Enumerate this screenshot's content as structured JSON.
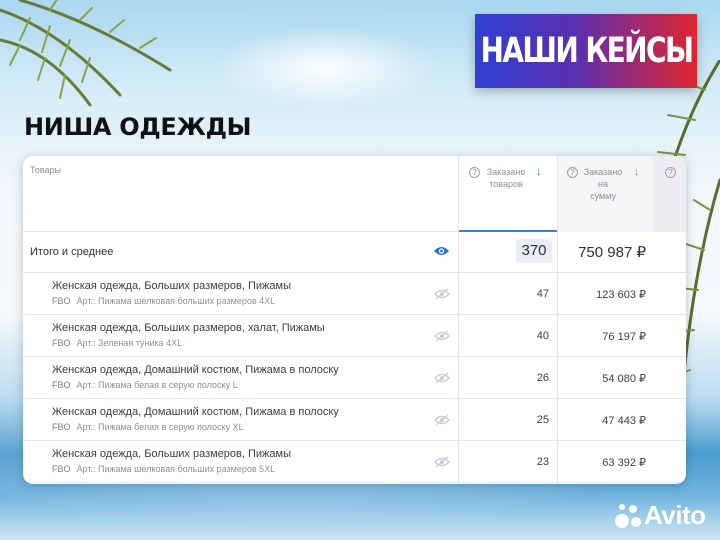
{
  "banner": {
    "label": "НАШИ КЕЙСЫ"
  },
  "niche_title": "НИША ОДЕЖДЫ",
  "table": {
    "header": {
      "goods": "Товары",
      "ordered_items_line1": "Заказано",
      "ordered_items_line2": "товаров",
      "ordered_sum_line1": "Заказано",
      "ordered_sum_line2": "на",
      "ordered_sum_line3": "сумму"
    },
    "total": {
      "label": "Итого и среднее",
      "count": "370",
      "sum": "750 987 ₽"
    },
    "rows": [
      {
        "name": "Женская одежда, Больших размеров, Пижамы",
        "fbo": "FBO",
        "article": "Арт.: Пижама шелковая больших размеров 4XL",
        "count": "47",
        "sum": "123 603 ₽"
      },
      {
        "name": "Женская одежда, Больших размеров, халат, Пижамы",
        "fbo": "FBO",
        "article": "Арт.: Зеленая туника 4XL",
        "count": "40",
        "sum": "76 197 ₽"
      },
      {
        "name": "Женская одежда, Домашний костюм, Пижама в полоску",
        "fbo": "FBO",
        "article": "Арт.: Пижама белая в серую полоску L",
        "count": "26",
        "sum": "54 080 ₽"
      },
      {
        "name": "Женская одежда, Домашний костюм, Пижама в полоску",
        "fbo": "FBO",
        "article": "Арт.: Пижама белая в серую полоску XL",
        "count": "25",
        "sum": "47 443 ₽"
      },
      {
        "name": "Женская одежда, Больших размеров, Пижамы",
        "fbo": "FBO",
        "article": "Арт.: Пижама шелковая больших размеров 5XL",
        "count": "23",
        "sum": "63 392 ₽"
      }
    ]
  },
  "icons": {
    "help": "help-circle-icon",
    "sort": "sort-arrow-icon",
    "visible": "eye-icon",
    "hidden": "eye-off-icon"
  },
  "colors": {
    "accent": "#2f80ed",
    "banner_start": "#2f3fd3",
    "banner_end": "#e0262f"
  },
  "watermark": {
    "brand": "Avito"
  }
}
